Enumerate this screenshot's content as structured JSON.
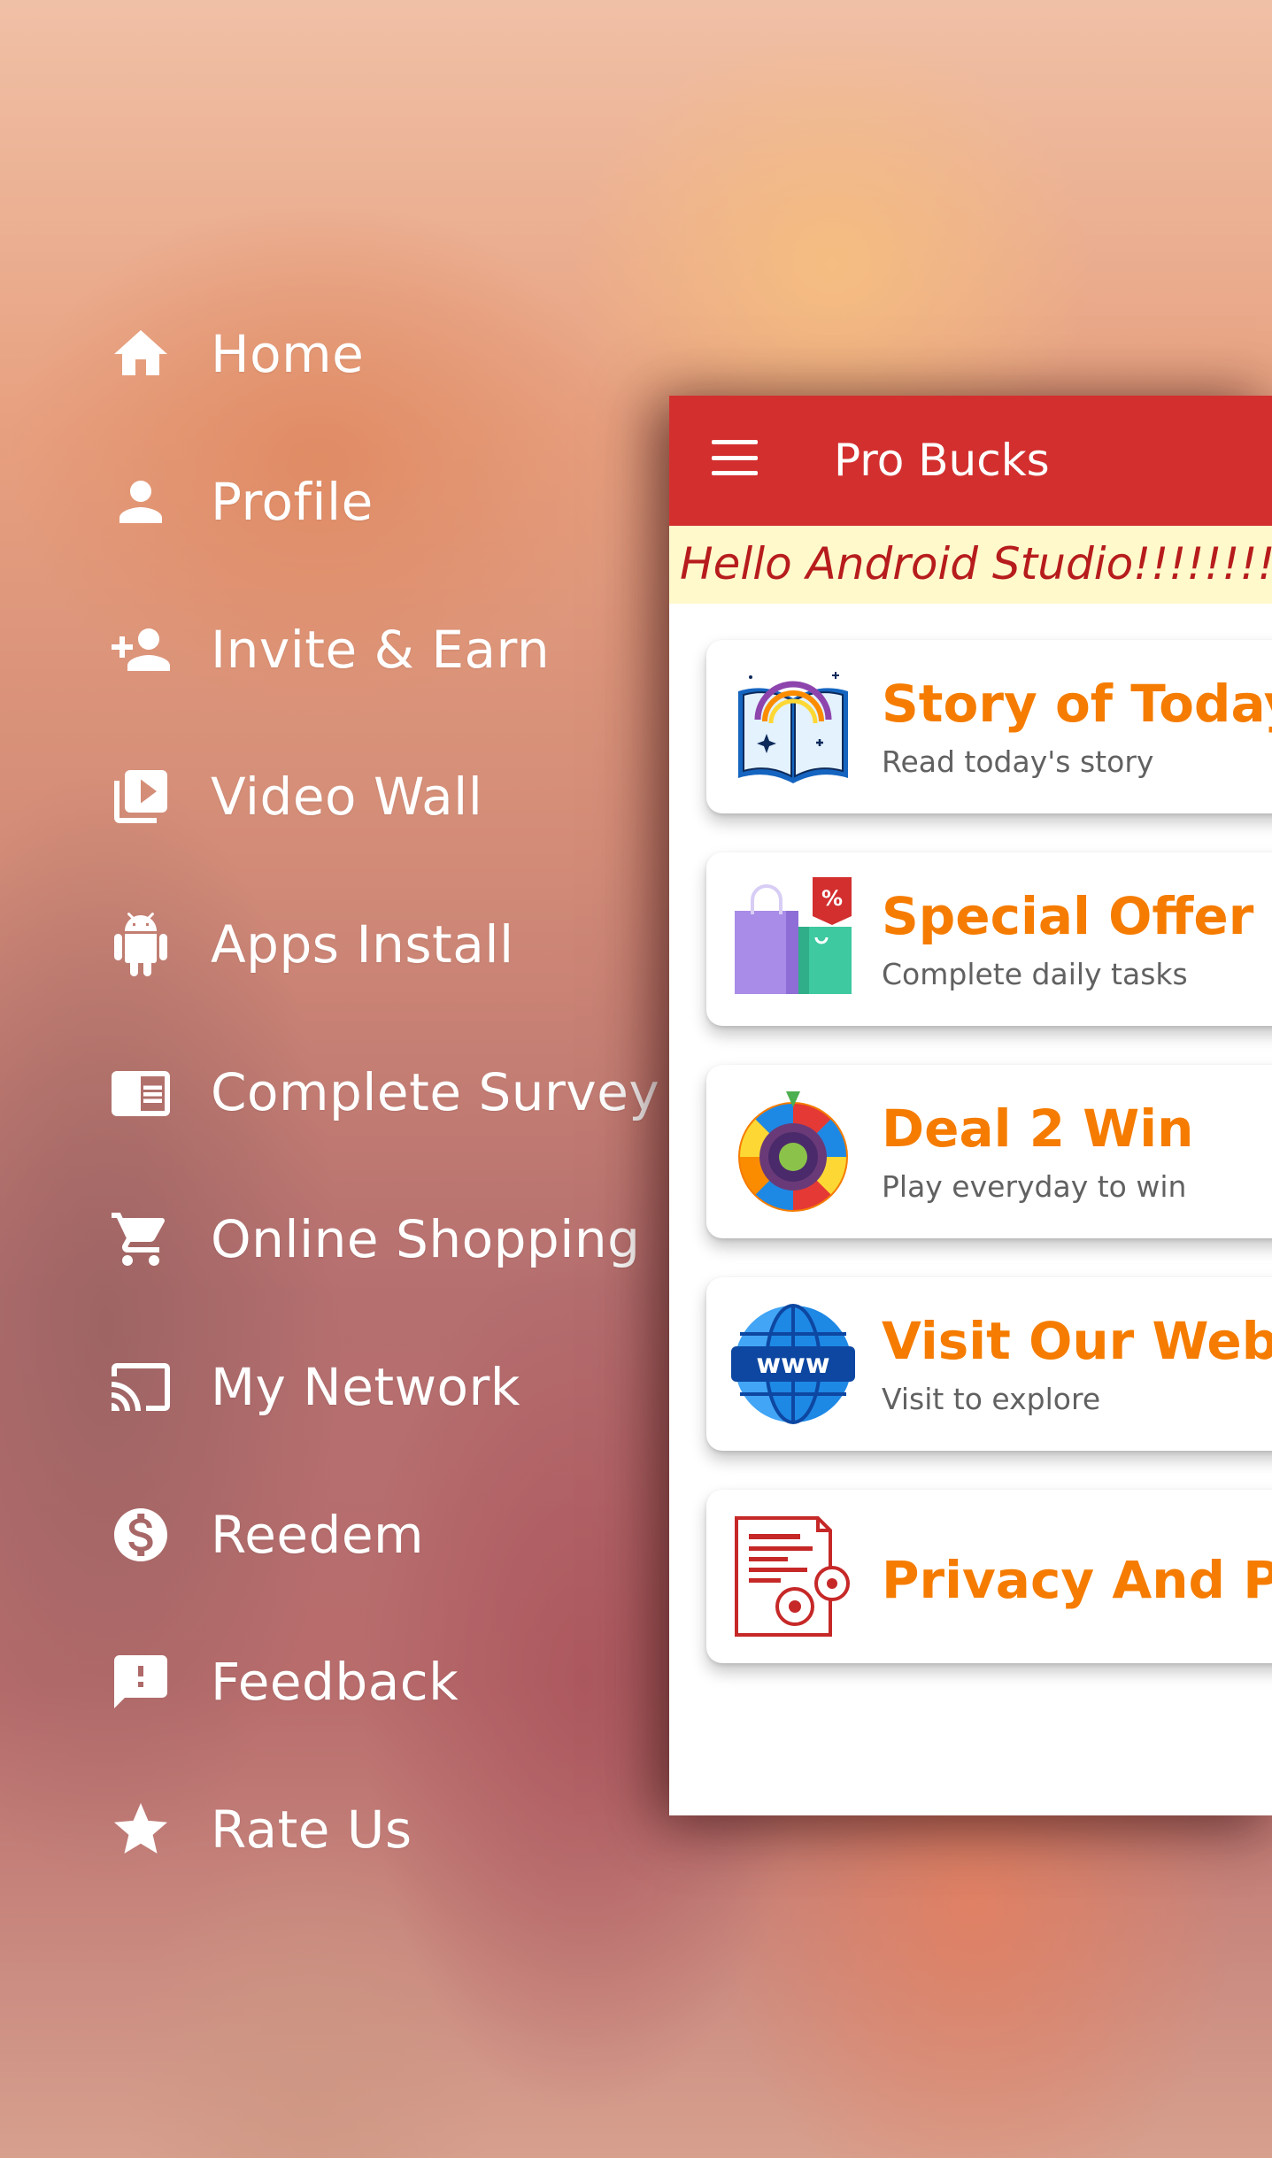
{
  "app": {
    "title": "Pro Bucks",
    "accent_color": "#d32f2f",
    "title_color": "#f57c00"
  },
  "ticker": {
    "text": "Hello Android Studio!!!!!!!!!!!!!!"
  },
  "drawer": {
    "items": [
      {
        "label": "Home",
        "icon": "home-icon"
      },
      {
        "label": "Profile",
        "icon": "person-icon"
      },
      {
        "label": "Invite & Earn",
        "icon": "person-add-icon"
      },
      {
        "label": "Video Wall",
        "icon": "video-library-icon"
      },
      {
        "label": "Apps Install",
        "icon": "android-icon"
      },
      {
        "label": "Complete Survey",
        "icon": "chrome-reader-icon"
      },
      {
        "label": "Online Shopping",
        "icon": "shopping-cart-icon"
      },
      {
        "label": "My Network",
        "icon": "cast-icon"
      },
      {
        "label": "Reedem",
        "icon": "dollar-coin-icon"
      },
      {
        "label": "Feedback",
        "icon": "feedback-icon"
      },
      {
        "label": "Rate Us",
        "icon": "star-icon"
      }
    ]
  },
  "cards": [
    {
      "title": "Story of Today",
      "subtitle": "Read today's story",
      "icon": "open-book-rainbow-icon"
    },
    {
      "title": "Special Offer",
      "subtitle": "Complete daily tasks",
      "icon": "shopping-bags-icon"
    },
    {
      "title": "Deal 2 Win",
      "subtitle": "Play everyday to win",
      "icon": "prize-wheel-icon"
    },
    {
      "title": "Visit Our Website",
      "subtitle": "Visit to explore",
      "icon": "www-globe-icon"
    },
    {
      "title": "Privacy And Policy",
      "subtitle": "",
      "icon": "policy-document-icon"
    }
  ]
}
